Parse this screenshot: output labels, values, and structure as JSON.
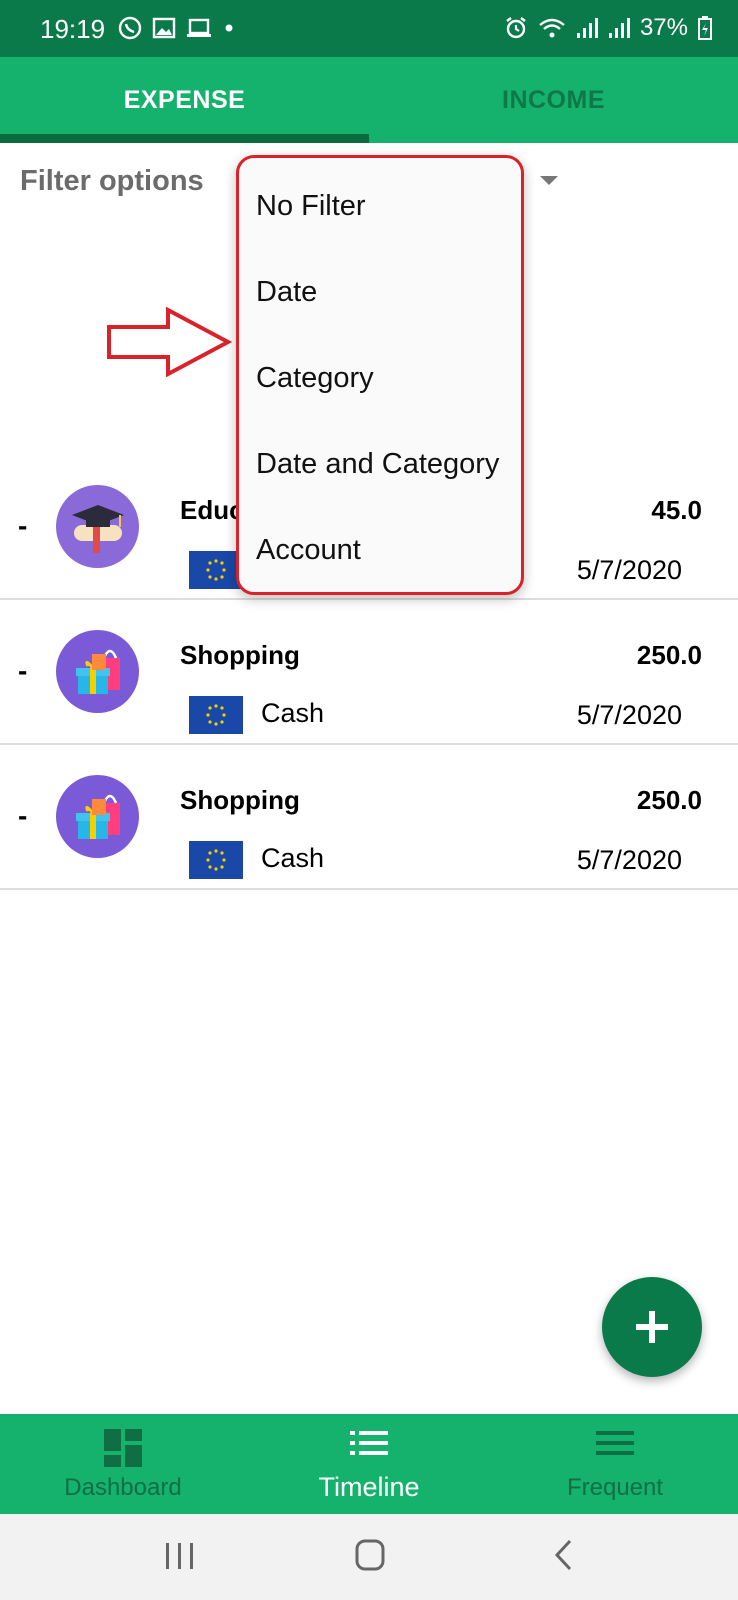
{
  "status_bar": {
    "time": "19:19",
    "battery": "37%",
    "icons": [
      "whatsapp-icon",
      "image-icon",
      "laptop-icon",
      "dot-icon",
      "alarm-icon",
      "wifi-icon",
      "signal-icon",
      "signal-r-icon",
      "battery-icon"
    ]
  },
  "tabs": [
    {
      "label": "EXPENSE",
      "active": true
    },
    {
      "label": "INCOME",
      "active": false
    }
  ],
  "filter": {
    "label": "Filter options",
    "options": [
      "No Filter",
      "Date",
      "Category",
      "Date and Category",
      "Account"
    ]
  },
  "transactions": [
    {
      "sign": "-",
      "category": "Educ",
      "amount": "45.0",
      "account": "",
      "date": "5/7/2020",
      "icon": "graduation-icon"
    },
    {
      "sign": "-",
      "category": "Shopping",
      "amount": "250.0",
      "account": "Cash",
      "date": "5/7/2020",
      "icon": "shopping-bags-icon"
    },
    {
      "sign": "-",
      "category": "Shopping",
      "amount": "250.0",
      "account": "Cash",
      "date": "5/7/2020",
      "icon": "shopping-bags-icon"
    }
  ],
  "bottom_nav": [
    {
      "label": "Dashboard",
      "icon": "dashboard-icon",
      "active": false
    },
    {
      "label": "Timeline",
      "icon": "list-icon",
      "active": true
    },
    {
      "label": "Frequent",
      "icon": "menu-icon",
      "active": false
    }
  ],
  "colors": {
    "primary": "#15b26d",
    "primary_dark": "#0a7a4a",
    "annotation": "#d9222a"
  }
}
